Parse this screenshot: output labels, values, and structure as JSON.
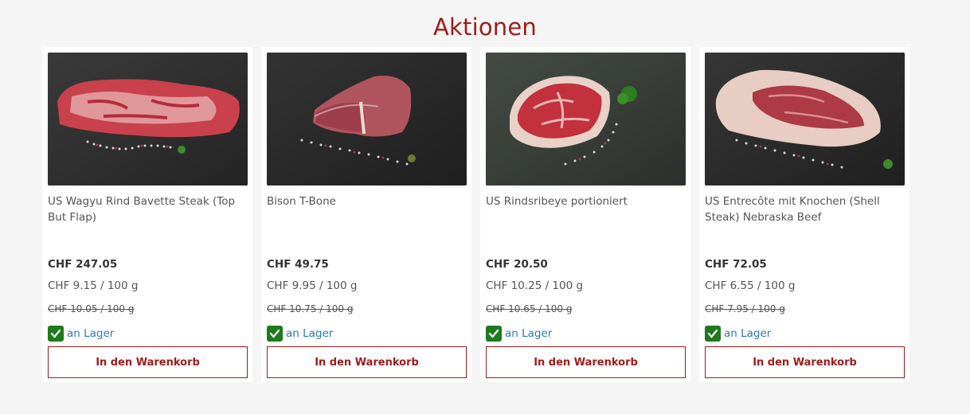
{
  "section": {
    "title": "Aktionen"
  },
  "products": [
    {
      "name": "US Wagyu Rind Bavette Steak (Top But Flap)",
      "price": "CHF 247.05",
      "unit_price": "CHF 9.15 / 100 g",
      "old_price": "CHF 10.05 / 100 g",
      "stock": "an Lager",
      "cart_label": "In den Warenkorb"
    },
    {
      "name": "Bison T-Bone",
      "price": "CHF 49.75",
      "unit_price": "CHF 9.95 / 100 g",
      "old_price": "CHF 10.75 / 100 g",
      "stock": "an Lager",
      "cart_label": "In den Warenkorb"
    },
    {
      "name": "US Rindsribeye portioniert",
      "price": "CHF 20.50",
      "unit_price": "CHF 10.25 / 100 g",
      "old_price": "CHF 10.65 / 100 g",
      "stock": "an Lager",
      "cart_label": "In den Warenkorb"
    },
    {
      "name": "US Entrecôte mit Knochen (Shell Steak) Nebraska Beef",
      "price": "CHF 72.05",
      "unit_price": "CHF 6.55 / 100 g",
      "old_price": "CHF 7.95 / 100 g",
      "stock": "an Lager",
      "cart_label": "In den Warenkorb"
    }
  ],
  "colors": {
    "accent": "#a01c1c",
    "stock_check": "#1e7a1e",
    "stock_text": "#2a7ab8",
    "background": "#f5f5f5"
  },
  "icons": {
    "stock": "checkmark-icon"
  }
}
